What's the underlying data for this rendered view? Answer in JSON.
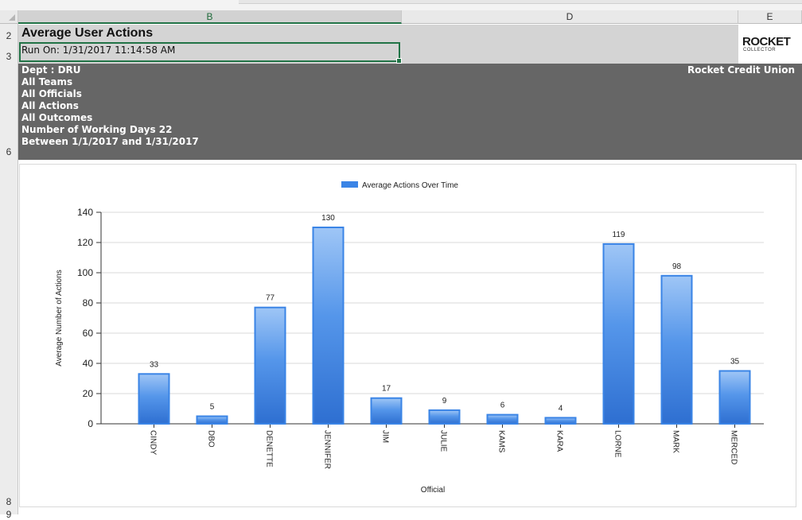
{
  "sheet": {
    "columns": [
      "B",
      "D",
      "E"
    ],
    "rows": [
      "2",
      "3",
      "6",
      "8",
      "9"
    ]
  },
  "report": {
    "title": "Average User Actions",
    "run_on": "Run On: 1/31/2017 11:14:58 AM",
    "logo_main": "ROCKET",
    "logo_sub": "COLLECTOR",
    "org": "Rocket Credit Union",
    "filters": [
      "Dept :  DRU",
      "All Teams",
      "All Officials",
      "All Actions",
      "All Outcomes",
      "Number of Working Days 22",
      "Between 1/1/2017 and 1/31/2017"
    ]
  },
  "chart_data": {
    "type": "bar",
    "title": "",
    "legend": "Average Actions Over Time",
    "legend_position": "top-center",
    "xlabel": "Official",
    "ylabel": "Average Number of Actions",
    "ylim": [
      0,
      140
    ],
    "yticks": [
      0,
      20,
      40,
      60,
      80,
      100,
      120,
      140
    ],
    "grid": true,
    "color": "#3a84e6",
    "categories": [
      "CINDY",
      "DBO",
      "DENETTE",
      "JENNIFER",
      "JIM",
      "JULIE",
      "KAMS",
      "KARA",
      "LORNE",
      "MARK",
      "MERCED"
    ],
    "values": [
      33,
      5,
      77,
      130,
      17,
      9,
      6,
      4,
      119,
      98,
      35
    ]
  }
}
